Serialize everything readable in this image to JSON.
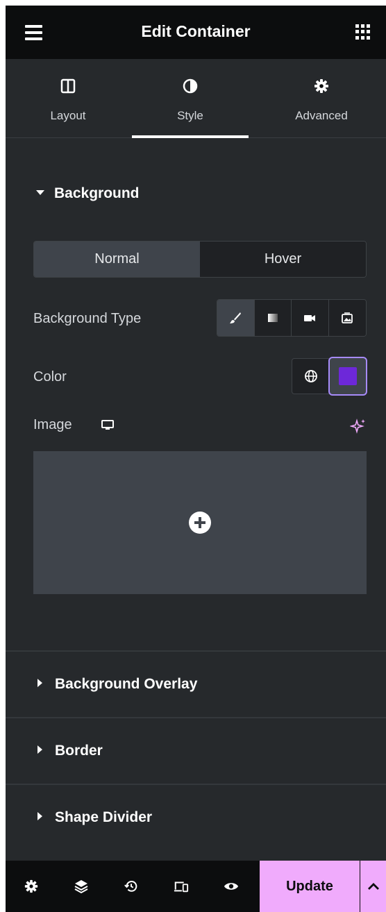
{
  "header": {
    "title": "Edit Container",
    "menu_icon": "hamburger-menu-icon",
    "grid_icon": "apps-grid-icon"
  },
  "tabs": [
    {
      "label": "Layout",
      "icon": "columns-icon"
    },
    {
      "label": "Style",
      "icon": "half-circle-contrast-icon",
      "active": true
    },
    {
      "label": "Advanced",
      "icon": "gear-icon"
    }
  ],
  "background": {
    "title": "Background",
    "state_tabs": {
      "normal": "Normal",
      "hover": "Hover",
      "active": "Normal"
    },
    "type_label": "Background Type",
    "type_options": [
      "brush-classic-icon",
      "gradient-icon",
      "video-icon",
      "slideshow-icon"
    ],
    "type_active": "brush-classic-icon",
    "color_label": "Color",
    "color_value": "#6d28d9",
    "image_label": "Image"
  },
  "collapsed_sections": {
    "overlay": "Background Overlay",
    "border": "Border",
    "shape_divider": "Shape Divider"
  },
  "footer": {
    "update_label": "Update",
    "icons": [
      "settings-icon",
      "layers-icon",
      "history-icon",
      "responsive-icon",
      "preview-eye-icon"
    ]
  },
  "colors": {
    "panel_bg": "#26292c",
    "header_bg": "#0c0d0e",
    "update_bg": "#f0abfc",
    "accent": "#a78bfa"
  }
}
